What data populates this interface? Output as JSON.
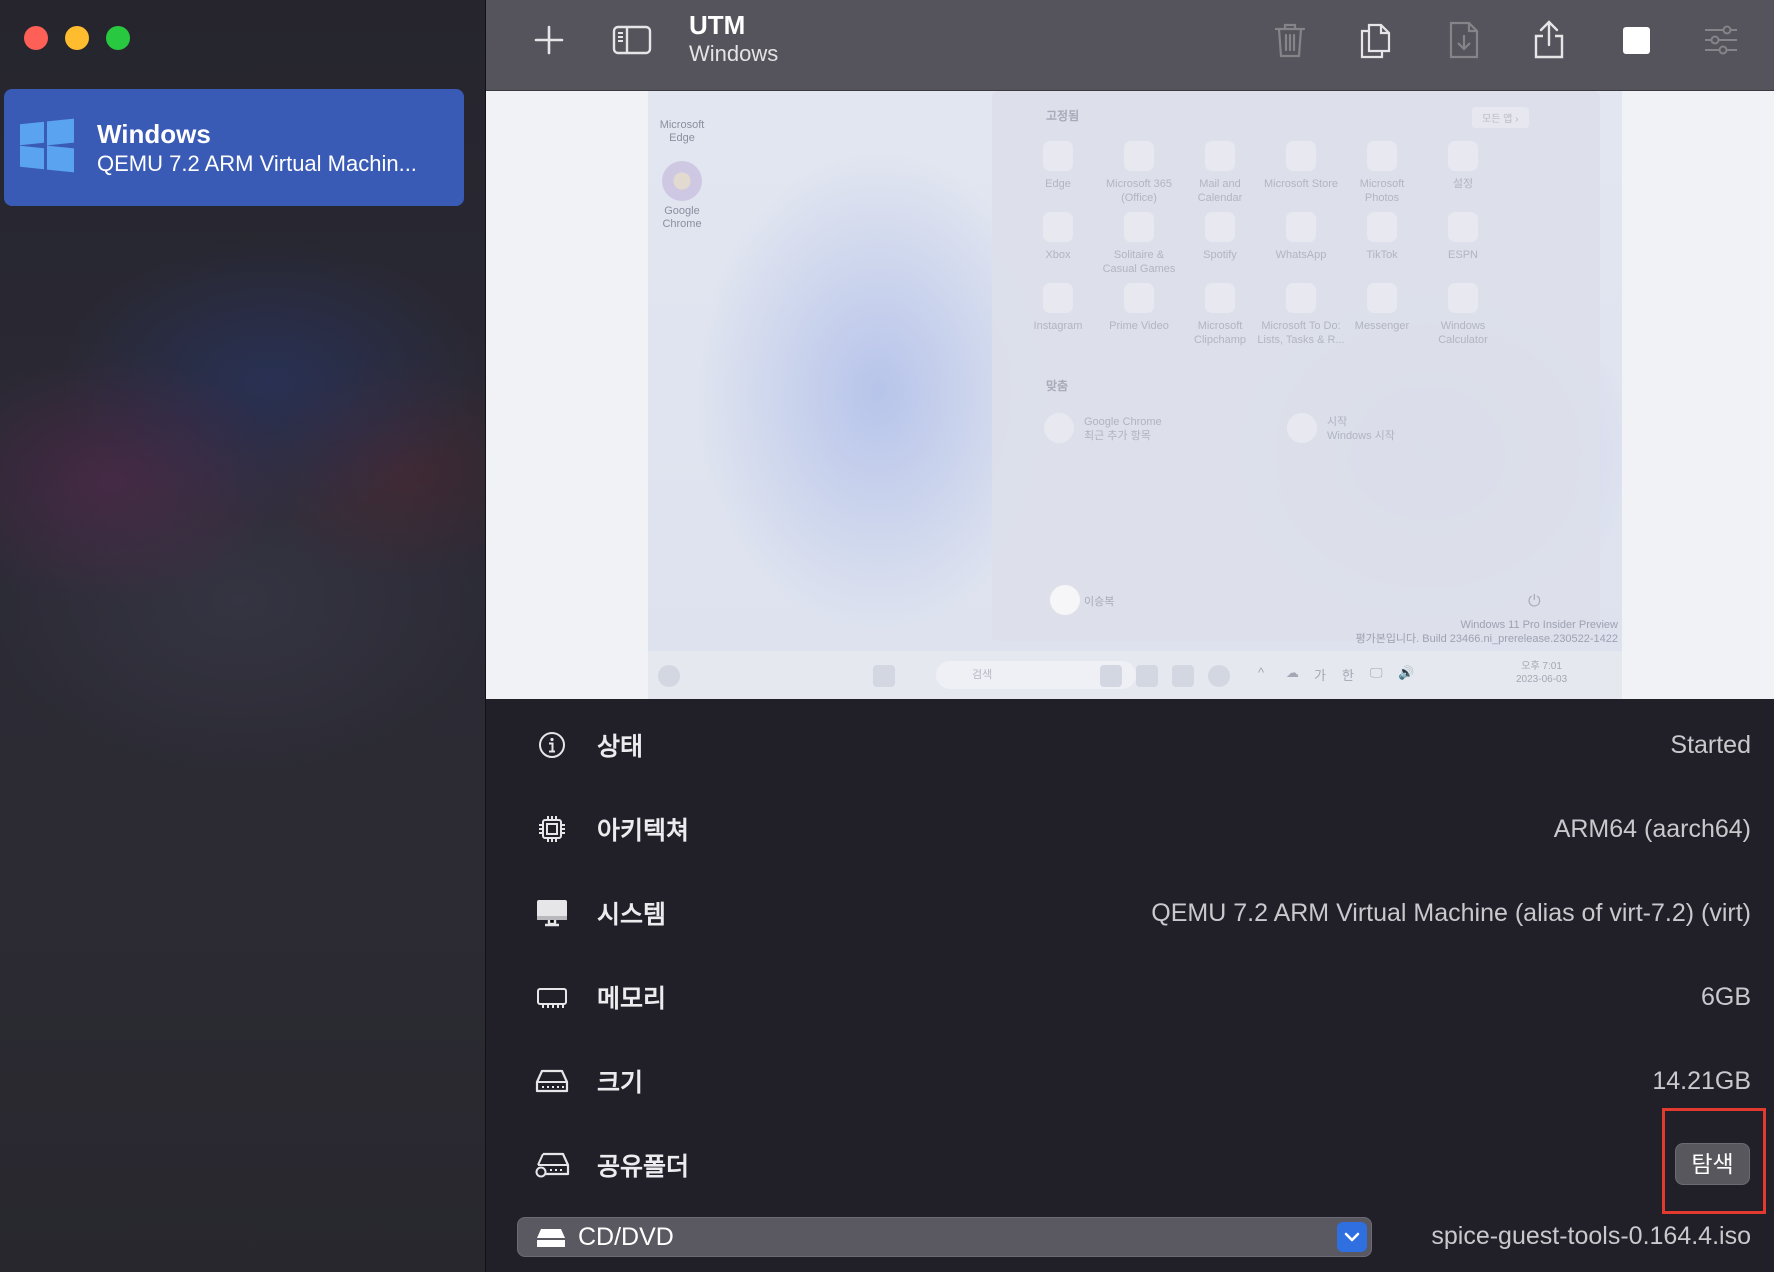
{
  "window": {
    "title": "UTM",
    "subtitle": "Windows"
  },
  "sidebar": {
    "vm": {
      "name": "Windows",
      "description": "QEMU 7.2 ARM Virtual Machin..."
    }
  },
  "toolbar": {
    "buttons": [
      "add-vm",
      "toggle-sidebar",
      "delete",
      "clone",
      "download",
      "share",
      "stop",
      "settings"
    ]
  },
  "preview": {
    "desktop_icons": [
      "Microsoft\nEdge",
      "Google\nChrome"
    ],
    "start_menu": {
      "pinned_header": "고정됨",
      "all_apps": "모든 앱  ›",
      "apps": [
        "Edge",
        "Microsoft 365\n(Office)",
        "Mail and\nCalendar",
        "Microsoft Store",
        "Microsoft\nPhotos",
        "설정",
        "Xbox",
        "Solitaire &\nCasual Games",
        "Spotify",
        "WhatsApp",
        "TikTok",
        "ESPN",
        "Instagram",
        "Prime Video",
        "Microsoft\nClipchamp",
        "Microsoft To Do:\nLists, Tasks & R...",
        "Messenger",
        "Windows\nCalculator"
      ],
      "recommended_header": "맞춤",
      "recommended": [
        {
          "title": "Google Chrome",
          "subtitle": "최근 추가 항목"
        },
        {
          "title": "시작",
          "subtitle": "Windows 시작"
        }
      ],
      "user": "이승복",
      "power": "⏻"
    },
    "watermark": "Windows 11 Pro Insider Preview\n평가본입니다. Build 23466.ni_prerelease.230522-1422",
    "taskbar": {
      "search_placeholder": "검색",
      "tray": [
        "^",
        "☁",
        "가",
        "한",
        "🖵",
        "🔊"
      ],
      "clock_time": "오후 7:01",
      "clock_date": "2023-06-03"
    }
  },
  "info": {
    "status": {
      "label": "상태",
      "value": "Started"
    },
    "architecture": {
      "label": "아키텍쳐",
      "value": "ARM64 (aarch64)"
    },
    "system": {
      "label": "시스템",
      "value": "QEMU 7.2 ARM Virtual Machine (alias of virt-7.2) (virt)"
    },
    "memory": {
      "label": "메모리",
      "value": "6GB"
    },
    "size": {
      "label": "크기",
      "value": "14.21GB"
    },
    "shared_folder": {
      "label": "공유폴더",
      "button": "탐색"
    },
    "cd_dvd": {
      "label": "CD/DVD",
      "value": "spice-guest-tools-0.164.4.iso"
    }
  },
  "colors": {
    "accent": "#3a5bb5",
    "highlight_box": "#e23a2e",
    "select_chevron": "#2f6fe0"
  }
}
